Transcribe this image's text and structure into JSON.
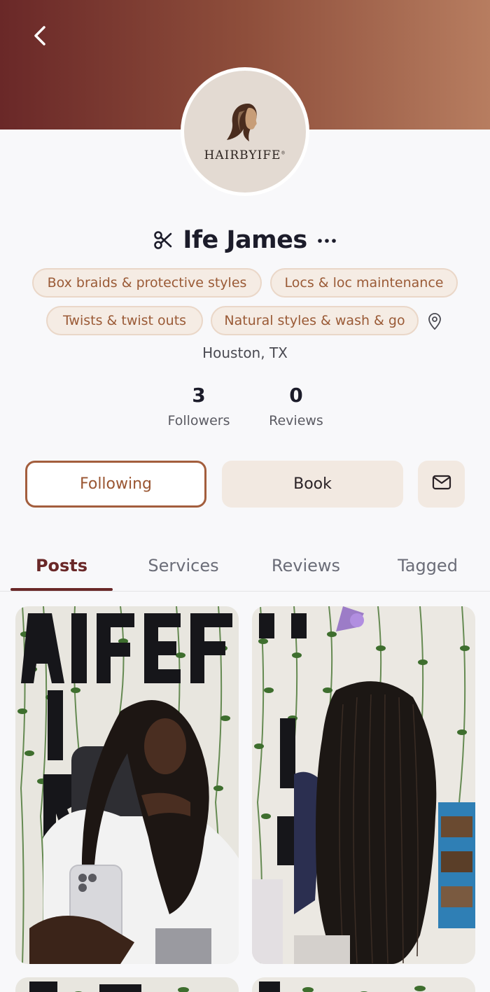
{
  "header": {
    "brand": {
      "text": "HAIRBYIFE",
      "trademark": "®"
    }
  },
  "profile": {
    "name": "Ife James",
    "specialties": [
      "Box braids & protective styles",
      "Locs & loc maintenance",
      "Twists & twist outs",
      "Natural styles & wash & go"
    ],
    "location": "Houston, TX",
    "stats": {
      "followers": {
        "value": "3",
        "label": "Followers"
      },
      "reviews": {
        "value": "0",
        "label": "Reviews"
      }
    }
  },
  "actions": {
    "following_label": "Following",
    "book_label": "Book",
    "message_icon": "mail-icon"
  },
  "tabs": [
    {
      "label": "Posts",
      "active": true
    },
    {
      "label": "Services",
      "active": false
    },
    {
      "label": "Reviews",
      "active": false
    },
    {
      "label": "Tagged",
      "active": false
    }
  ],
  "icons": {
    "back": "chevron-left-icon",
    "scissors": "scissors-icon",
    "more": "more-horizontal-icon",
    "location": "map-pin-icon"
  },
  "colors": {
    "accent": "#6a2828",
    "chip_text": "#9a5a36",
    "chip_bg": "#f5ece4",
    "following_border": "#a35e3d",
    "book_bg": "#f2e9e1"
  }
}
